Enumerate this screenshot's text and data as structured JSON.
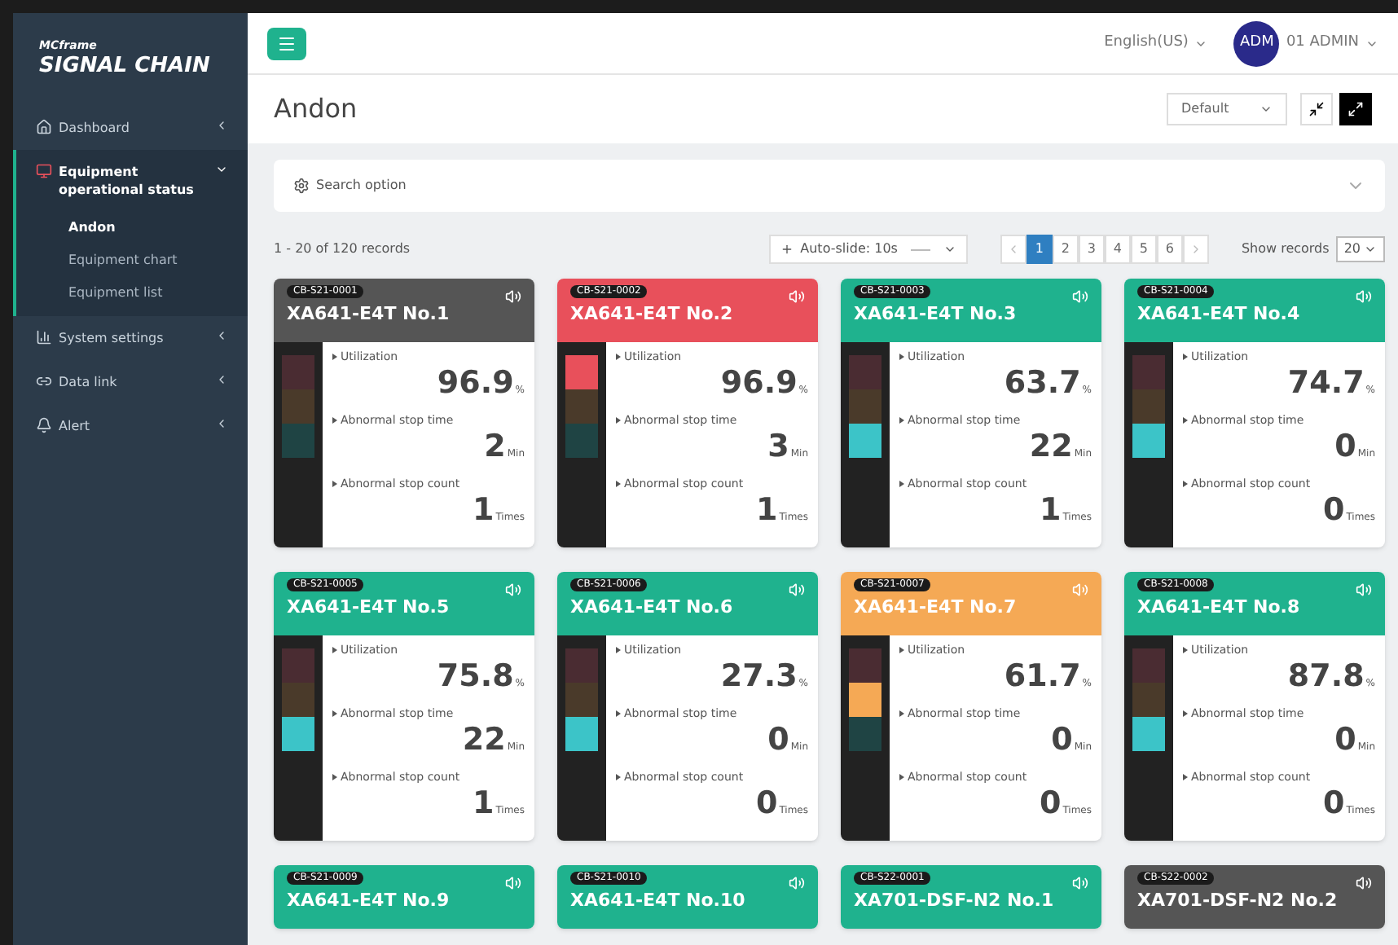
{
  "sidebar": {
    "brand_small": "MCframe",
    "brand": "SIGNAL CHAIN",
    "items": [
      {
        "label": "Dashboard",
        "kind": "home",
        "expanded": false,
        "selected": false
      },
      {
        "label": "Equipment operational status",
        "kind": "monitor",
        "expanded": true,
        "selected": true,
        "children": [
          {
            "label": "Andon",
            "selected": true
          },
          {
            "label": "Equipment chart",
            "selected": false
          },
          {
            "label": "Equipment list",
            "selected": false
          }
        ]
      },
      {
        "label": "System settings",
        "kind": "chart",
        "expanded": false,
        "selected": false
      },
      {
        "label": "Data link",
        "kind": "link",
        "expanded": false,
        "selected": false
      },
      {
        "label": "Alert",
        "kind": "bell",
        "expanded": false,
        "selected": false
      }
    ]
  },
  "topbar": {
    "language": "English(US)",
    "avatar": "ADM",
    "user": "01 ADMIN"
  },
  "page": {
    "title": "Andon",
    "view": "Default"
  },
  "search": {
    "label": "Search option"
  },
  "list": {
    "records": "1 - 20 of 120 records",
    "autoslide": "Auto-slide: 10s",
    "pages": [
      {
        "label": "1",
        "selected": true
      },
      {
        "label": "2",
        "selected": false
      },
      {
        "label": "3",
        "selected": false
      },
      {
        "label": "4",
        "selected": false
      },
      {
        "label": "5",
        "selected": false
      },
      {
        "label": "6",
        "selected": false
      }
    ],
    "show_records": "Show records",
    "per_page": "20"
  },
  "cards": [
    {
      "code": "CB-S21-0001",
      "name": "XA641-E4T No.1",
      "color": "#555555",
      "lamps": [
        {
          "on": false
        },
        {
          "on": false
        },
        {
          "on": false
        }
      ],
      "metrics": [
        {
          "label": "Utilization",
          "value": "96.9",
          "unit": "%"
        },
        {
          "label": "Abnormal stop time",
          "value": "2",
          "unit": "Min"
        },
        {
          "label": "Abnormal stop count",
          "value": "1",
          "unit": "Times"
        }
      ]
    },
    {
      "code": "CB-S21-0002",
      "name": "XA641-E4T No.2",
      "color": "#e8505b",
      "lamps": [
        {
          "on": true
        },
        {
          "on": false
        },
        {
          "on": false
        }
      ],
      "metrics": [
        {
          "label": "Utilization",
          "value": "96.9",
          "unit": "%"
        },
        {
          "label": "Abnormal stop time",
          "value": "3",
          "unit": "Min"
        },
        {
          "label": "Abnormal stop count",
          "value": "1",
          "unit": "Times"
        }
      ]
    },
    {
      "code": "CB-S21-0003",
      "name": "XA641-E4T No.3",
      "color": "#1fb28e",
      "lamps": [
        {
          "on": false
        },
        {
          "on": false
        },
        {
          "on": true
        }
      ],
      "metrics": [
        {
          "label": "Utilization",
          "value": "63.7",
          "unit": "%"
        },
        {
          "label": "Abnormal stop time",
          "value": "22",
          "unit": "Min"
        },
        {
          "label": "Abnormal stop count",
          "value": "1",
          "unit": "Times"
        }
      ]
    },
    {
      "code": "CB-S21-0004",
      "name": "XA641-E4T No.4",
      "color": "#1fb28e",
      "lamps": [
        {
          "on": false
        },
        {
          "on": false
        },
        {
          "on": true
        }
      ],
      "metrics": [
        {
          "label": "Utilization",
          "value": "74.7",
          "unit": "%"
        },
        {
          "label": "Abnormal stop time",
          "value": "0",
          "unit": "Min"
        },
        {
          "label": "Abnormal stop count",
          "value": "0",
          "unit": "Times"
        }
      ]
    },
    {
      "code": "CB-S21-0005",
      "name": "XA641-E4T No.5",
      "color": "#1fb28e",
      "lamps": [
        {
          "on": false
        },
        {
          "on": false
        },
        {
          "on": true
        }
      ],
      "metrics": [
        {
          "label": "Utilization",
          "value": "75.8",
          "unit": "%"
        },
        {
          "label": "Abnormal stop time",
          "value": "22",
          "unit": "Min"
        },
        {
          "label": "Abnormal stop count",
          "value": "1",
          "unit": "Times"
        }
      ]
    },
    {
      "code": "CB-S21-0006",
      "name": "XA641-E4T No.6",
      "color": "#1fb28e",
      "lamps": [
        {
          "on": false
        },
        {
          "on": false
        },
        {
          "on": true
        }
      ],
      "metrics": [
        {
          "label": "Utilization",
          "value": "27.3",
          "unit": "%"
        },
        {
          "label": "Abnormal stop time",
          "value": "0",
          "unit": "Min"
        },
        {
          "label": "Abnormal stop count",
          "value": "0",
          "unit": "Times"
        }
      ]
    },
    {
      "code": "CB-S21-0007",
      "name": "XA641-E4T No.7",
      "color": "#f5a955",
      "lamps": [
        {
          "on": false
        },
        {
          "on": true
        },
        {
          "on": false
        }
      ],
      "metrics": [
        {
          "label": "Utilization",
          "value": "61.7",
          "unit": "%"
        },
        {
          "label": "Abnormal stop time",
          "value": "0",
          "unit": "Min"
        },
        {
          "label": "Abnormal stop count",
          "value": "0",
          "unit": "Times"
        }
      ]
    },
    {
      "code": "CB-S21-0008",
      "name": "XA641-E4T No.8",
      "color": "#1fb28e",
      "lamps": [
        {
          "on": false
        },
        {
          "on": false
        },
        {
          "on": true
        }
      ],
      "metrics": [
        {
          "label": "Utilization",
          "value": "87.8",
          "unit": "%"
        },
        {
          "label": "Abnormal stop time",
          "value": "0",
          "unit": "Min"
        },
        {
          "label": "Abnormal stop count",
          "value": "0",
          "unit": "Times"
        }
      ]
    },
    {
      "code": "CB-S21-0009",
      "name": "XA641-E4T No.9",
      "color": "#1fb28e"
    },
    {
      "code": "CB-S21-0010",
      "name": "XA641-E4T No.10",
      "color": "#1fb28e"
    },
    {
      "code": "CB-S22-0001",
      "name": "XA701-DSF-N2 No.1",
      "color": "#1fb28e"
    },
    {
      "code": "CB-S22-0002",
      "name": "XA701-DSF-N2 No.2",
      "color": "#555555"
    }
  ]
}
